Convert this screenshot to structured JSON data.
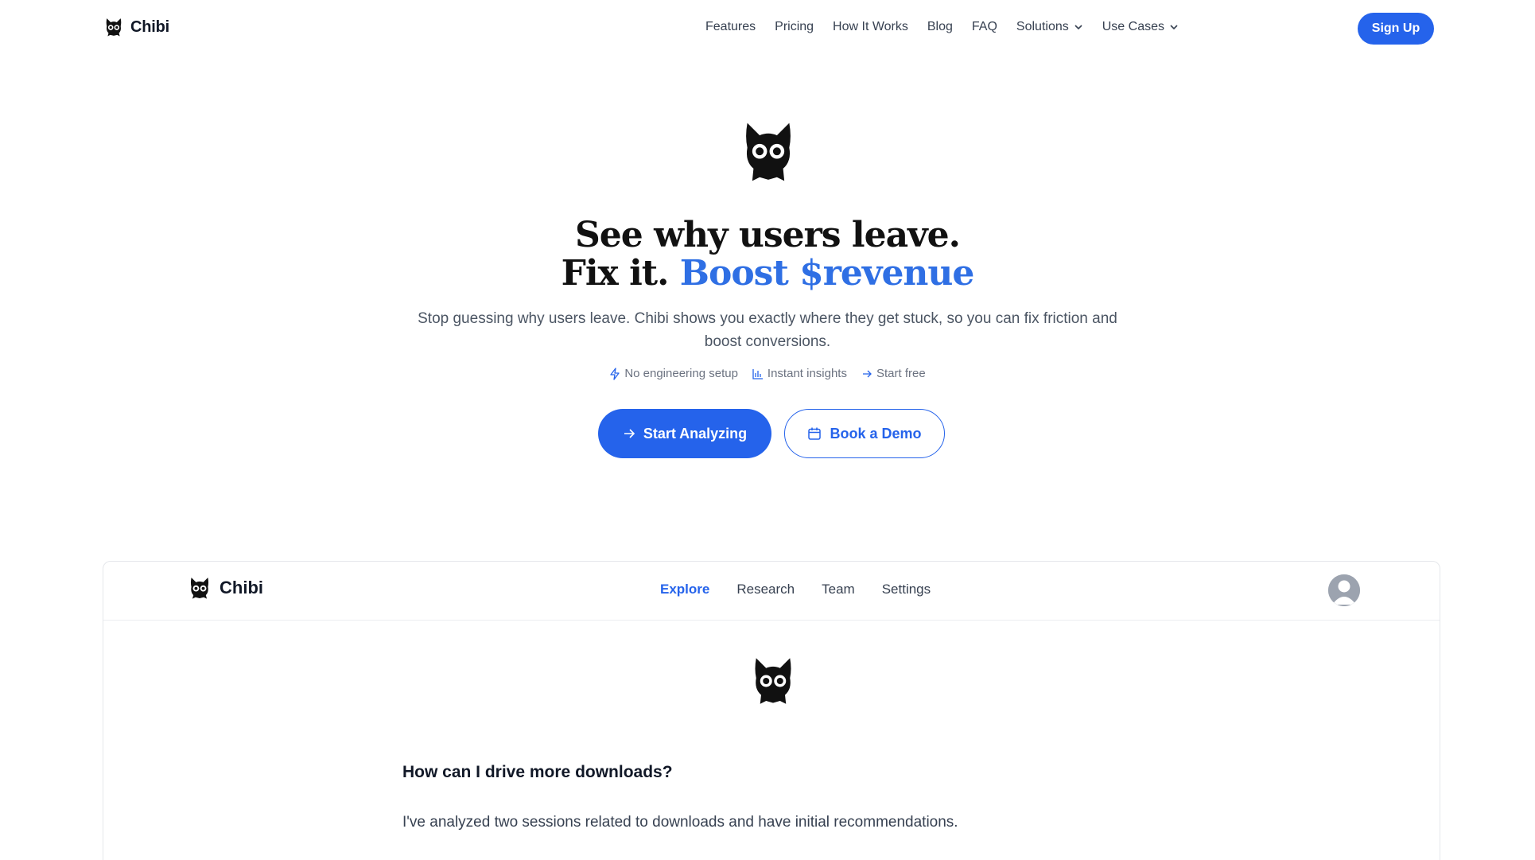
{
  "brand": {
    "name": "Chibi",
    "logo_icon": "cat-logo-icon"
  },
  "nav": {
    "items": [
      {
        "label": "Features"
      },
      {
        "label": "Pricing"
      },
      {
        "label": "How It Works"
      },
      {
        "label": "Blog"
      },
      {
        "label": "FAQ"
      },
      {
        "label": "Solutions",
        "icon": "chevron-down-icon"
      },
      {
        "label": "Use Cases",
        "icon": "chevron-down-icon"
      }
    ],
    "signup_label": "Sign Up"
  },
  "hero": {
    "headline_line1": "See why users leave.",
    "headline_line2_plain": "Fix it.",
    "headline_line2_accent": "Boost $revenue",
    "subtitle": "Stop guessing why users leave. Chibi shows you exactly where they get stuck, so you can fix friction and boost conversions.",
    "features": [
      {
        "label": "No engineering setup",
        "icon": "lightning-icon"
      },
      {
        "label": "Instant insights",
        "icon": "bar-chart-icon"
      },
      {
        "label": "Start free",
        "icon": "arrow-right-icon"
      }
    ],
    "primary_cta": "Start Analyzing",
    "secondary_cta": "Book a Demo"
  },
  "preview": {
    "brand_name": "Chibi",
    "tabs": [
      {
        "label": "Explore",
        "active": true
      },
      {
        "label": "Research",
        "active": false
      },
      {
        "label": "Team",
        "active": false
      },
      {
        "label": "Settings",
        "active": false
      }
    ],
    "question": "How can I drive more downloads?",
    "answer": "I've analyzed two sessions related to downloads and have initial recommendations."
  },
  "colors": {
    "accent": "#2563eb",
    "headline_accent": "#2f6fe4",
    "text": "#111827",
    "muted": "#6b7280"
  }
}
